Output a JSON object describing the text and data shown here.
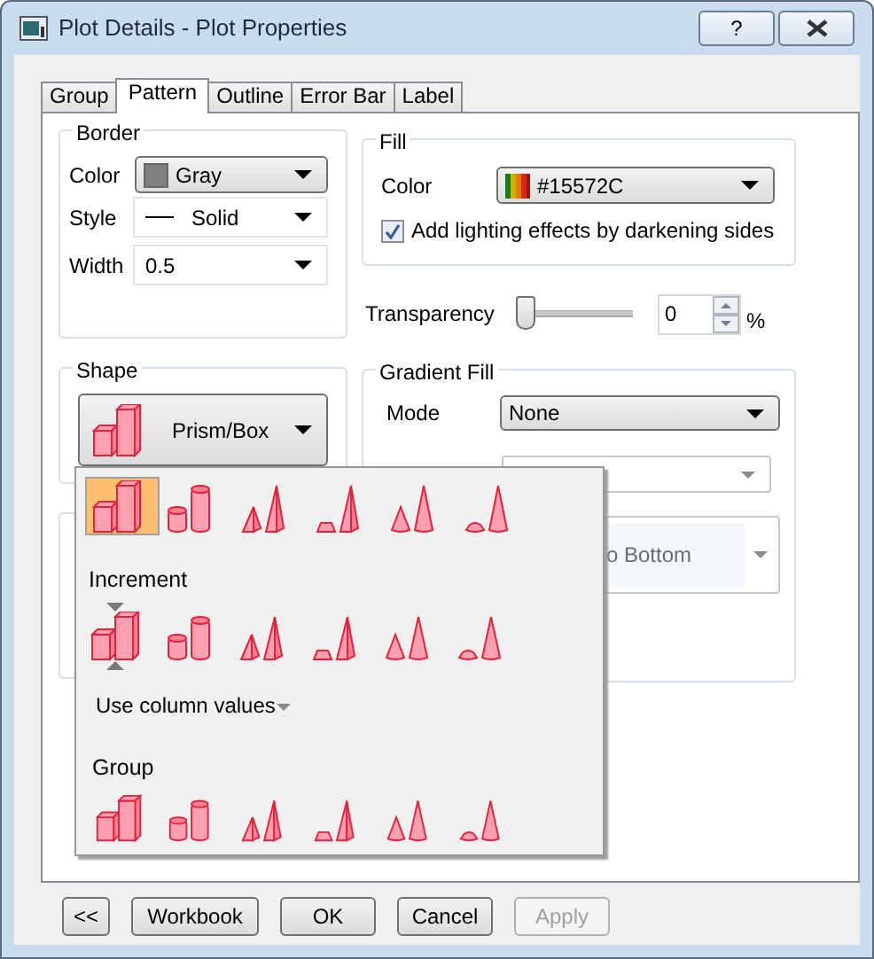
{
  "window": {
    "title": "Plot Details - Plot Properties",
    "help_button": "?"
  },
  "tabs": [
    {
      "label": "Group",
      "selected": false
    },
    {
      "label": "Pattern",
      "selected": true
    },
    {
      "label": "Outline",
      "selected": false
    },
    {
      "label": "Error Bar",
      "selected": false
    },
    {
      "label": "Label",
      "selected": false
    }
  ],
  "border": {
    "title": "Border",
    "color_label": "Color",
    "color_value": "Gray",
    "style_label": "Style",
    "style_value": "Solid",
    "width_label": "Width",
    "width_value": "0.5"
  },
  "fill": {
    "title": "Fill",
    "color_label": "Color",
    "color_value": "#15572C",
    "lighting": {
      "label": "Add lighting effects by darkening sides",
      "checked": true
    }
  },
  "transparency": {
    "label": "Transparency",
    "level": 0,
    "value": "0",
    "unit": "%"
  },
  "shape": {
    "title": "Shape",
    "value": "Prism/Box"
  },
  "gradient_fill": {
    "title": "Gradient Fill",
    "mode_label": "Mode",
    "mode_value": "None",
    "direction_value": "o Bottom"
  },
  "shape_popup": {
    "shapes": [
      {
        "kind": "prism",
        "selected": true
      },
      {
        "kind": "cylinder",
        "selected": false
      },
      {
        "kind": "pyramid",
        "selected": false
      },
      {
        "kind": "frustum-pyramid",
        "selected": false
      },
      {
        "kind": "cone",
        "selected": false
      },
      {
        "kind": "frustum-cone",
        "selected": false
      }
    ],
    "increment_label": "Increment",
    "increment": [
      {
        "kind": "prism",
        "selected": true
      },
      {
        "kind": "cylinder",
        "selected": false
      },
      {
        "kind": "pyramid",
        "selected": false
      },
      {
        "kind": "frustum-pyramid",
        "selected": false
      },
      {
        "kind": "cone",
        "selected": false
      },
      {
        "kind": "frustum-cone",
        "selected": false
      }
    ],
    "column_values": "Use column values",
    "group_label": "Group",
    "group": [
      {
        "kind": "prism"
      },
      {
        "kind": "cylinder"
      },
      {
        "kind": "pyramid"
      },
      {
        "kind": "frustum-pyramid"
      },
      {
        "kind": "cone"
      },
      {
        "kind": "frustum-cone"
      }
    ]
  },
  "buttons": [
    {
      "label": "<<",
      "disabled": false
    },
    {
      "label": "Workbook",
      "disabled": false
    },
    {
      "label": "OK",
      "disabled": false
    },
    {
      "label": "Cancel",
      "disabled": false
    },
    {
      "label": "Apply",
      "disabled": true
    }
  ]
}
